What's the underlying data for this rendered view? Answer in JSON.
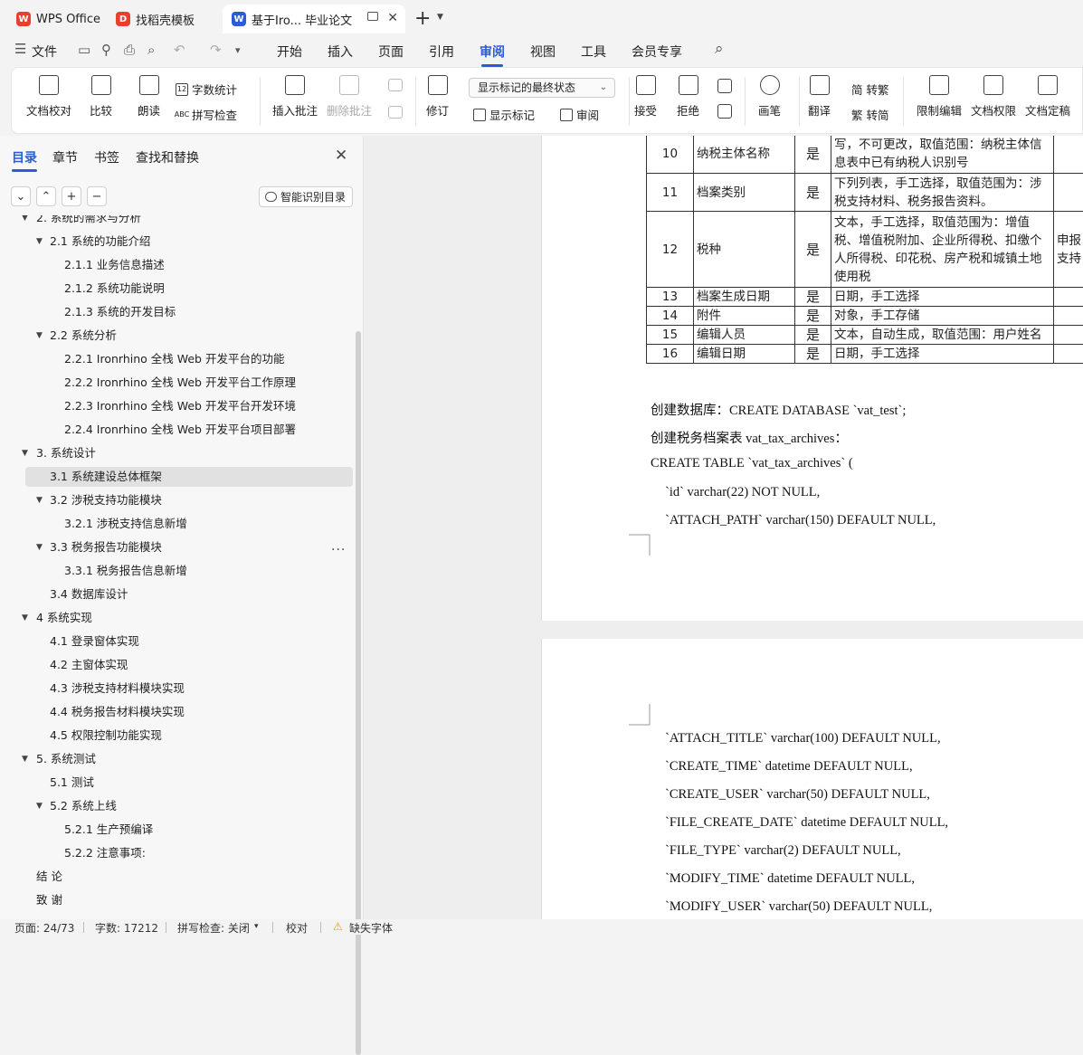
{
  "tabs": [
    {
      "label": "WPS Office",
      "icon": "wps-logo-icon",
      "color": "#e8402f"
    },
    {
      "label": "找稻壳模板",
      "icon": "docer-logo-icon",
      "color": "#e8402f"
    },
    {
      "label": "基于Iro... 毕业论文",
      "icon": "word-doc-icon",
      "color": "#2b5bd7"
    }
  ],
  "menu": {
    "file": "文件",
    "items": [
      "开始",
      "插入",
      "页面",
      "引用",
      "审阅",
      "视图",
      "工具",
      "会员专享"
    ],
    "active": "审阅"
  },
  "ribbon": {
    "doc_check": "文档校对",
    "compare": "比较",
    "read_aloud": "朗读",
    "word_count": "字数统计",
    "spell_check": "拼写检查",
    "insert_comment": "插入批注",
    "delete_comment": "删除批注",
    "revise": "修订",
    "markup_state": "显示标记的最终状态",
    "show_markup": "显示标记",
    "review": "审阅",
    "accept": "接受",
    "reject": "拒绝",
    "pen": "画笔",
    "translate": "翻译",
    "to_traditional": "简 转繁",
    "to_simplified": "繁 转简",
    "restrict_edit": "限制编辑",
    "doc_permission": "文档权限",
    "doc_finalize": "文档定稿"
  },
  "nav": {
    "tabs": [
      "目录",
      "章节",
      "书签",
      "查找和替换"
    ],
    "smart_toc": "智能识别目录",
    "toc": [
      {
        "text": "2. 系统的需求与分析",
        "level": 1,
        "caret": true
      },
      {
        "text": "2.1 系统的功能介绍",
        "level": 2,
        "caret": true
      },
      {
        "text": "2.1.1  业务信息描述",
        "level": 3
      },
      {
        "text": "2.1.2  系统功能说明",
        "level": 3
      },
      {
        "text": "2.1.3  系统的开发目标",
        "level": 3
      },
      {
        "text": "2.2  系统分析",
        "level": 2,
        "caret": true
      },
      {
        "text": "2.2.1 Ironrhino 全栈 Web 开发平台的功能",
        "level": 3
      },
      {
        "text": "2.2.2 Ironrhino 全栈 Web 开发平台工作原理",
        "level": 3
      },
      {
        "text": "2.2.3 Ironrhino 全栈 Web 开发平台开发环境",
        "level": 3
      },
      {
        "text": "2.2.4 Ironrhino 全栈 Web 开发平台项目部署",
        "level": 3
      },
      {
        "text": "3.  系统设计",
        "level": 1,
        "caret": true
      },
      {
        "text": "3.1  系统建设总体框架",
        "level": 2,
        "selected": true
      },
      {
        "text": "3.2    涉税支持功能模块",
        "level": 2,
        "caret": true
      },
      {
        "text": "3.2.1    涉税支持信息新增",
        "level": 3
      },
      {
        "text": "3.3    税务报告功能模块",
        "level": 2,
        "caret": true
      },
      {
        "text": "3.3.1    税务报告信息新增",
        "level": 3
      },
      {
        "text": "3.4    数据库设计",
        "level": 2
      },
      {
        "text": "4    系统实现",
        "level": 1,
        "caret": true
      },
      {
        "text": "4.1 登录窗体实现",
        "level": 2
      },
      {
        "text": "4.2    主窗体实现",
        "level": 2
      },
      {
        "text": "4.3    涉税支持材料模块实现",
        "level": 2
      },
      {
        "text": "4.4    税务报告材料模块实现",
        "level": 2
      },
      {
        "text": "4.5    权限控制功能实现",
        "level": 2
      },
      {
        "text": "5.  系统测试",
        "level": 1,
        "caret": true
      },
      {
        "text": "5.1  测试",
        "level": 2
      },
      {
        "text": "5.2    系统上线",
        "level": 2,
        "caret": true
      },
      {
        "text": "5.2.1 生产预编译",
        "level": 3
      },
      {
        "text": "5.2.2  注意事项:",
        "level": 3
      },
      {
        "text": "结    论",
        "level": 1
      },
      {
        "text": "致    谢",
        "level": 1
      }
    ]
  },
  "table_rows": [
    {
      "no": "10",
      "name": "纳税主体名称",
      "req": "是",
      "desc": "写，不可更改，取值范围：纳税主体信息表中已有纳税人识别号",
      "extra": ""
    },
    {
      "no": "11",
      "name": "档案类别",
      "req": "是",
      "desc": "下列列表，手工选择，取值范围为：涉税支持材料、税务报告资料。",
      "extra": ""
    },
    {
      "no": "12",
      "name": "税种",
      "req": "是",
      "desc": "文本，手工选择，取值范围为：增值税、增值税附加、企业所得税、扣缴个人所得税、印花税、房产税和城镇土地使用税",
      "extra": "申报 支持"
    },
    {
      "no": "13",
      "name": "档案生成日期",
      "req": "是",
      "desc": "日期，手工选择",
      "extra": ""
    },
    {
      "no": "14",
      "name": "附件",
      "req": "是",
      "desc": "对象，手工存储",
      "extra": ""
    },
    {
      "no": "15",
      "name": "编辑人员",
      "req": "是",
      "desc": "文本，自动生成，取值范围：用户姓名",
      "extra": ""
    },
    {
      "no": "16",
      "name": "编辑日期",
      "req": "是",
      "desc": "日期，手工选择",
      "extra": ""
    }
  ],
  "page1_lines": [
    "创建数据库：CREATE DATABASE `vat_test`;",
    "创建税务档案表 vat_tax_archives：",
    "CREATE TABLE `vat_tax_archives` (",
    "`id` varchar(22) NOT NULL,",
    "`ATTACH_PATH` varchar(150) DEFAULT NULL,"
  ],
  "page2_lines": [
    "`ATTACH_TITLE` varchar(100) DEFAULT NULL,",
    "`CREATE_TIME` datetime DEFAULT NULL,",
    "`CREATE_USER` varchar(50) DEFAULT NULL,",
    "`FILE_CREATE_DATE` datetime DEFAULT NULL,",
    "`FILE_TYPE` varchar(2) DEFAULT NULL,",
    "`MODIFY_TIME` datetime DEFAULT NULL,",
    "`MODIFY_USER` varchar(50) DEFAULT NULL,"
  ],
  "status": {
    "page": "页面: 24/73",
    "words": "字数: 17212",
    "spell": "拼写检查: 关闭",
    "proof": "校对",
    "missing_font": "缺失字体"
  }
}
